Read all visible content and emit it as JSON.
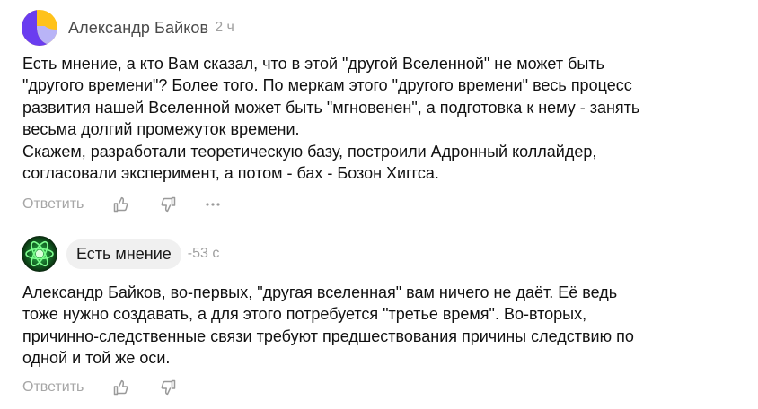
{
  "comments": [
    {
      "author": "Александр Байков",
      "time": "2 ч",
      "lines": [
        "Есть мнение, а кто Вам сказал, что в этой \"другой Вселенной\" не может быть",
        "\"другого времени\"? Более того. По меркам этого \"другого времени\" весь процесс",
        "развития нашей Вселенной может быть \"мгновенен\", а подготовка к нему - занять",
        "весьма долгий промежуток времени.",
        "Скажем, разработали теоретическую базу, построили Адронный коллайдер,",
        "согласовали эксперимент, а потом - бах - Бозон Хиггса."
      ],
      "reply_label": "Ответить",
      "icons": {
        "avatar": "purple-yellow-avatar-icon",
        "like": "thumbs-up-icon",
        "dislike": "thumbs-down-icon",
        "more": "more-dots-icon"
      }
    },
    {
      "author": "Есть мнение",
      "time": "-53 с",
      "lines": [
        "Александр Байков, во-первых, \"другая вселенная\" вам ничего не даёт. Её ведь",
        "тоже нужно создавать, а для этого потребуется \"третье время\". Во-вторых,",
        "причинно-следственные связи требуют предшествования причины следствию по",
        "одной и той же оси."
      ],
      "reply_label": "Ответить",
      "icons": {
        "avatar": "green-atom-avatar-icon",
        "like": "thumbs-up-icon",
        "dislike": "thumbs-down-icon"
      }
    }
  ],
  "colors": {
    "avatar_purple": "#6a3df0",
    "avatar_yellow": "#ffc21a",
    "atom_green": "#2ee85a",
    "muted_text": "#a6a6a6",
    "chip_bg": "#f0f0f0"
  }
}
